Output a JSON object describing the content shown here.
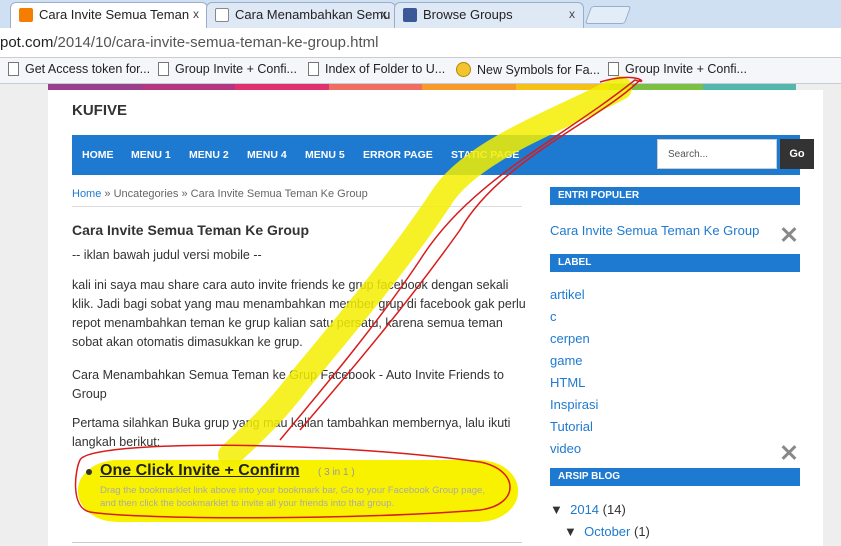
{
  "browser": {
    "tabs": [
      {
        "title": "Cara Invite Semua Teman",
        "icon": "blogger-icon",
        "color": "#f57d00"
      },
      {
        "title": "Cara Menambahkan Semu",
        "icon": "page-icon",
        "color": "#ffffff"
      },
      {
        "title": "Browse Groups",
        "icon": "facebook-icon",
        "color": "#3b5998"
      }
    ],
    "close_label": "x",
    "url_prefix": "pot.com",
    "url_path": "/2014/10/cara-invite-semua-teman-ke-group.html",
    "bookmarks": [
      "Get Access token for...",
      "Group Invite + Confi...",
      "Index of Folder to U...",
      "New Symbols for Fa...",
      "Group Invite + Confi..."
    ]
  },
  "blog": {
    "title": "KUFIVE",
    "strip_colors": [
      "#9a3f8c",
      "#b43680",
      "#e0316e",
      "#ef6e61",
      "#f59a2b",
      "#f6c116",
      "#7bc043",
      "#54b6ad"
    ],
    "nav": [
      "HOME",
      "MENU 1",
      "MENU 2",
      "MENU 4",
      "MENU 5",
      "ERROR PAGE",
      "STATIC PAGE"
    ],
    "search_placeholder": "Search...",
    "go_label": "Go",
    "breadcrumb": {
      "home": "Home",
      "sep1": " » ",
      "cat": "Uncategories",
      "sep2": " » ",
      "current": "Cara Invite Semua Teman Ke Group"
    },
    "post": {
      "title": "Cara Invite Semua Teman Ke Group",
      "ad": "-- iklan bawah judul versi mobile --",
      "p1": "kali ini saya mau share cara auto invite friends ke grup facebook dengan sekali klik. Jadi bagi sobat yang mau menambahkan member grup di facebook gak perlu repot menambahkan teman ke grup kalian satu persatu, karena semua teman sobat akan otomatis dimasukkan ke grup.",
      "p2": "Cara Menambahkan Semua Teman ke Grup Facebook - Auto Invite Friends to Group",
      "p3": "Pertama silahkan Buka grup yang mau kalian tambahkan membernya, lalu ikuti langkah berikut:",
      "oneclick": "One Click Invite + Confirm",
      "oneclick_note": "( 3 in 1 )",
      "oneclick_desc": "Drag the bookmarklet link above into your bookmark bar, Go to your Facebook Group page, and then click the bookmarklet to invite all your friends into that group."
    },
    "sidebar": {
      "popular_heading": "ENTRI POPULER",
      "popular_item": "Cara Invite Semua Teman Ke Group",
      "label_heading": "LABEL",
      "labels": [
        "artikel",
        "c",
        "cerpen",
        "game",
        "HTML",
        "Inspirasi",
        "Tutorial",
        "video"
      ],
      "archive_heading": "ARSIP BLOG",
      "archive_year": "2014",
      "archive_year_count": "(14)",
      "archive_month": "October",
      "archive_month_count": "(1)",
      "arrow": "▼"
    }
  }
}
